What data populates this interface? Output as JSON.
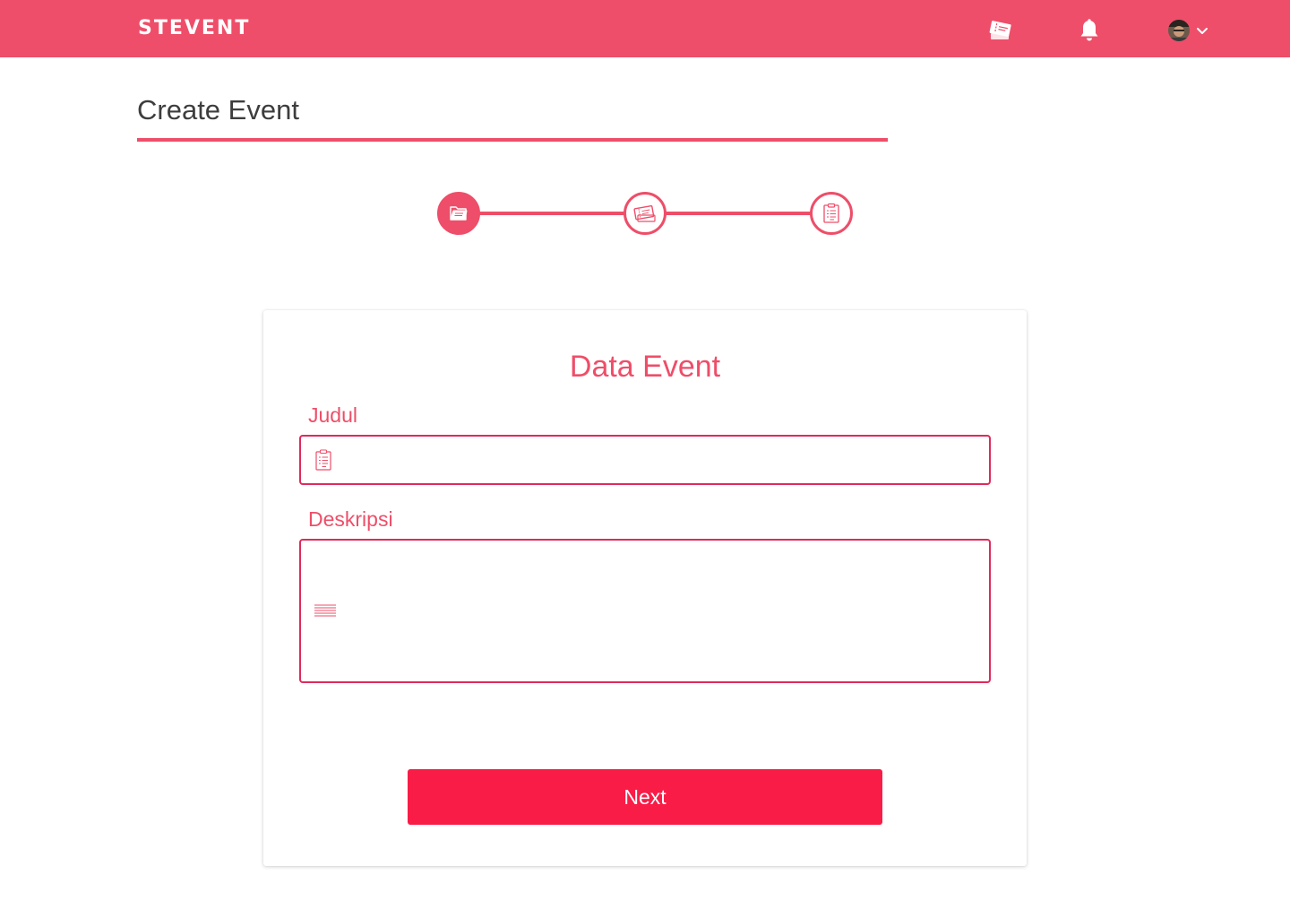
{
  "app": {
    "brand": "STEVENT",
    "accent_color": "#ee4e69",
    "button_color": "#f91c47"
  },
  "navbar": {
    "icons": [
      "tickets-icon",
      "bell-icon",
      "avatar",
      "chevron-down-icon"
    ]
  },
  "page": {
    "title": "Create Event"
  },
  "stepper": {
    "steps": [
      {
        "icon": "folder-icon",
        "active": true
      },
      {
        "icon": "ticket-icon",
        "active": false
      },
      {
        "icon": "clipboard-icon",
        "active": false
      }
    ]
  },
  "form": {
    "title": "Data Event",
    "judul": {
      "label": "Judul",
      "value": "",
      "placeholder": "",
      "icon": "clipboard-icon"
    },
    "deskripsi": {
      "label": "Deskripsi",
      "value": "",
      "placeholder": "",
      "icon": "text-lines-icon"
    },
    "next_label": "Next"
  }
}
